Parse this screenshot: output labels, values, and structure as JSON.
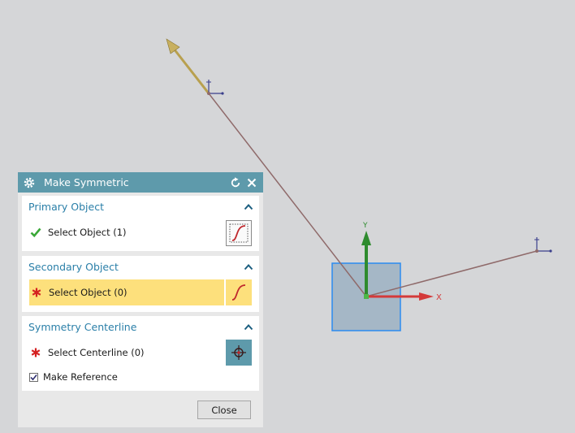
{
  "dialog": {
    "title": "Make Symmetric",
    "primary": {
      "title": "Primary Object",
      "select_label": "Select Object (1)",
      "status": "done"
    },
    "secondary": {
      "title": "Secondary Object",
      "select_label": "Select Object (0)",
      "status": "required"
    },
    "centerline": {
      "title": "Symmetry Centerline",
      "select_label": "Select Centerline (0)",
      "status": "required"
    },
    "make_reference": {
      "label": "Make Reference",
      "checked": true
    },
    "close_label": "Close"
  },
  "viewport": {
    "axis_y_label": "Y",
    "axis_x_label": "X"
  },
  "colors": {
    "titlebar": "#5e9aab",
    "group_title": "#2a7fa8",
    "active_row": "#fde07c",
    "check": "#3aa838",
    "required": "#d42020",
    "line": "#8f6a6a",
    "axis_y": "#2e8b2e",
    "axis_x": "#d43a3a",
    "plane_fill": "#a5b7c6",
    "plane_border": "#2b8bf0"
  }
}
